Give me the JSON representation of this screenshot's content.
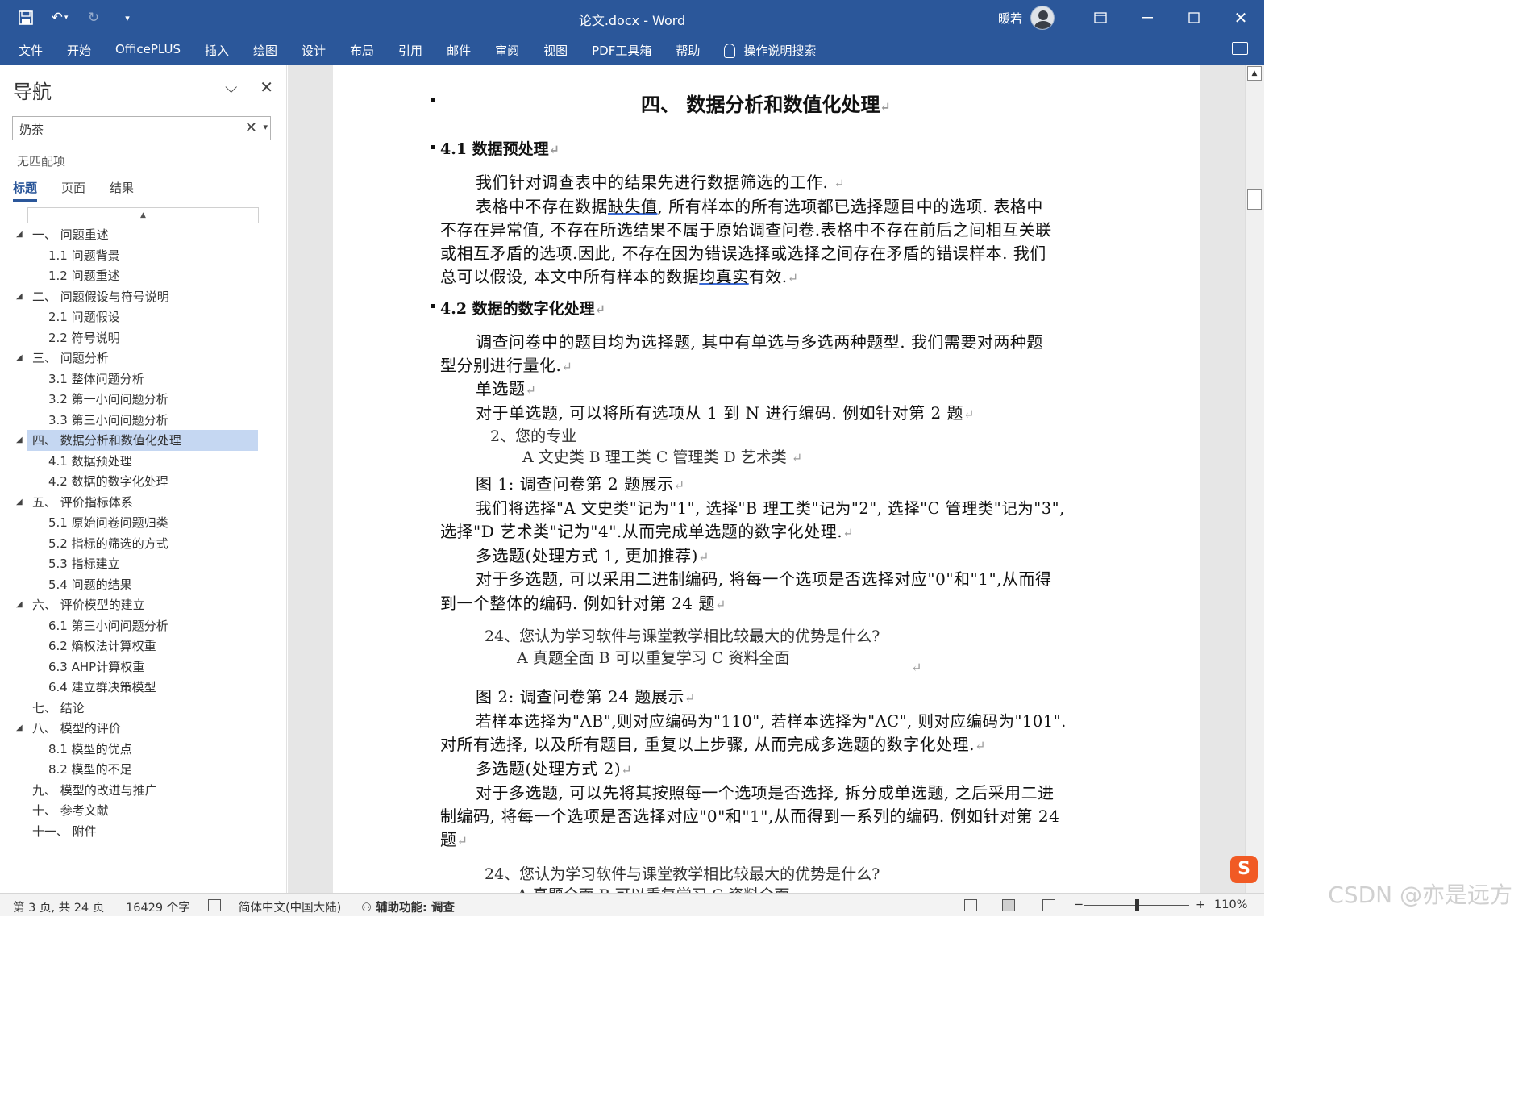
{
  "window": {
    "title": "论文.docx  -  Word",
    "user_name": "暖若",
    "quick_access": {
      "customize_icon": "▾"
    }
  },
  "ribbon": {
    "tabs": [
      "文件",
      "开始",
      "OfficePLUS",
      "插入",
      "绘图",
      "设计",
      "布局",
      "引用",
      "邮件",
      "审阅",
      "视图",
      "PDF工具箱",
      "帮助"
    ],
    "search_label": "操作说明搜索"
  },
  "nav": {
    "title": "导航",
    "search_value": "奶茶",
    "no_match": "无匹配项",
    "tabs": [
      "标题",
      "页面",
      "结果"
    ],
    "active_tab": "标题",
    "items": [
      {
        "level": 1,
        "text": "一、 问题重述",
        "expanded": true
      },
      {
        "level": 2,
        "text": "1.1 问题背景"
      },
      {
        "level": 2,
        "text": "1.2 问题重述"
      },
      {
        "level": 1,
        "text": "二、 问题假设与符号说明",
        "expanded": true
      },
      {
        "level": 2,
        "text": "2.1 问题假设"
      },
      {
        "level": 2,
        "text": "2.2 符号说明"
      },
      {
        "level": 1,
        "text": "三、 问题分析",
        "expanded": true
      },
      {
        "level": 2,
        "text": "3.1 整体问题分析"
      },
      {
        "level": 2,
        "text": "3.2 第一小问问题分析"
      },
      {
        "level": 2,
        "text": "3.3 第三小问问题分析"
      },
      {
        "level": 1,
        "text": "四、 数据分析和数值化处理",
        "expanded": true,
        "selected": true
      },
      {
        "level": 2,
        "text": "4.1 数据预处理"
      },
      {
        "level": 2,
        "text": "4.2 数据的数字化处理"
      },
      {
        "level": 1,
        "text": "五、 评价指标体系",
        "expanded": true
      },
      {
        "level": 2,
        "text": "5.1 原始问卷问题归类"
      },
      {
        "level": 2,
        "text": "5.2 指标的筛选的方式"
      },
      {
        "level": 2,
        "text": "5.3 指标建立"
      },
      {
        "level": 2,
        "text": "5.4 问题的结果"
      },
      {
        "level": 1,
        "text": "六、 评价模型的建立",
        "expanded": true
      },
      {
        "level": 2,
        "text": "6.1 第三小问问题分析"
      },
      {
        "level": 2,
        "text": "6.2 熵权法计算权重"
      },
      {
        "level": 2,
        "text": "6.3 AHP计算权重"
      },
      {
        "level": 2,
        "text": "6.4 建立群决策模型"
      },
      {
        "level": 1,
        "text": "七、 结论",
        "expanded": false
      },
      {
        "level": 1,
        "text": "八、 模型的评价",
        "expanded": true
      },
      {
        "level": 2,
        "text": "8.1 模型的优点"
      },
      {
        "level": 2,
        "text": "8.2 模型的不足"
      },
      {
        "level": 1,
        "text": "九、 模型的改进与推广",
        "expanded": false
      },
      {
        "level": 1,
        "text": "十、 参考文献",
        "expanded": false
      },
      {
        "level": 1,
        "text": "十一、 附件",
        "expanded": false
      }
    ]
  },
  "document": {
    "h1": "四、  数据分析和数值化处理",
    "h2_1": "4.1 数据预处理",
    "p1": "我们针对调查表中的结果先进行数据筛选的工作.",
    "p2_l1_a": "表格中不存在数据",
    "p2_l1_b": "缺失值",
    "p2_l1_c": ", 所有样本的所有选项都已选择题目中的选项. 表格中",
    "p2_l2": "不存在异常值, 不存在所选结果不属于原始调查问卷.表格中不存在前后之间相互关联",
    "p2_l3": "或相互矛盾的选项.因此, 不存在因为错误选择或选择之间存在矛盾的错误样本. 我们",
    "p2_l4_a": "总可以假设, 本文中所有样本的数据",
    "p2_l4_b": "均真实",
    "p2_l4_c": "有效.",
    "h2_2": "4.2 数据的数字化处理",
    "p3_l1": "调查问卷中的题目均为选择题, 其中有单选与多选两种题型. 我们需要对两种题",
    "p3_l2": "型分别进行量化.",
    "p4": "单选题",
    "p5": "对于单选题, 可以将所有选项从 1 到 N 进行编码. 例如针对第 2 题",
    "q2": "2、您的专业",
    "q2_opts": "A  文史类    B  理工类    C 管理类    D  艺术类",
    "fig1": "图 1:  调查问卷第 2 题展示",
    "p6_l1": "我们将选择\"A 文史类\"记为\"1\", 选择\"B 理工类\"记为\"2\", 选择\"C 管理类\"记为\"3\",",
    "p6_l2": "选择\"D 艺术类\"记为\"4\".从而完成单选题的数字化处理.",
    "p7": "多选题(处理方式 1, 更加推荐)",
    "p8_l1": "对于多选题, 可以采用二进制编码, 将每一个选项是否选择对应\"0\"和\"1\",从而得",
    "p8_l2": "到一个整体的编码. 例如针对第 24 题",
    "q24": "24、您认为学习软件与课堂教学相比较最大的优势是什么?",
    "q24_opts": "A 真题全面    B  可以重复学习  C  资料全面",
    "fig2": "图 2:  调查问卷第 24 题展示",
    "p9_l1": "若样本选择为\"AB\",则对应编码为\"110\", 若样本选择为\"AC\", 则对应编码为\"101\".",
    "p9_l2": "对所有选择, 以及所有题目, 重复以上步骤, 从而完成多选题的数字化处理.",
    "p10": "多选题(处理方式 2)",
    "p11_l1": "对于多选题, 可以先将其按照每一个选项是否选择, 拆分成单选题, 之后采用二进",
    "p11_l2": "制编码, 将每一个选项是否选择对应\"0\"和\"1\",从而得到一系列的编码. 例如针对第  24",
    "p11_l3": "题",
    "q24b": "24、您认为学习软件与课堂教学相比较最大的优势是什么?",
    "q24b_opts": "A 真题全面    B  可以重复学习  C  资料全面"
  },
  "status": {
    "page": "第 3 页, 共 24 页",
    "words": "16429 个字",
    "language": "简体中文(中国大陆)",
    "accessibility": "辅助功能: 调查",
    "zoom": "110%"
  },
  "watermark": "CSDN @亦是远方"
}
